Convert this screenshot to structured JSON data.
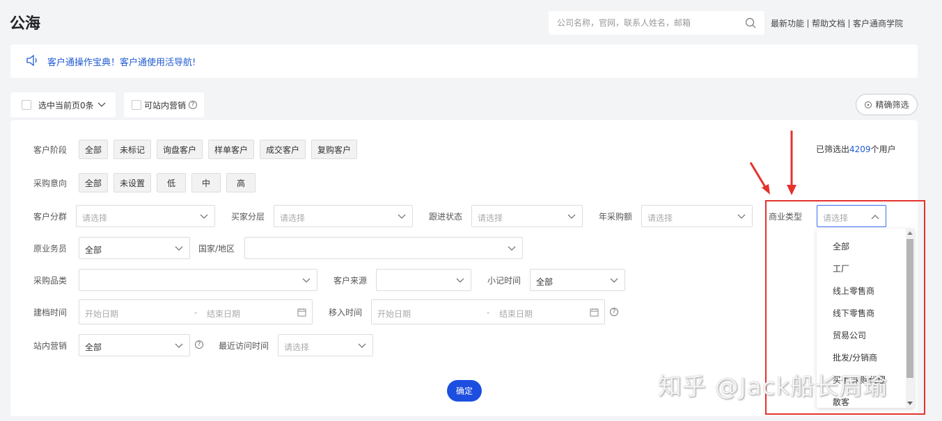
{
  "page": {
    "title": "公海"
  },
  "search": {
    "placeholder": "公司名称，官网，联系人姓名，邮箱"
  },
  "top_links": [
    "最新功能",
    "帮助文档",
    "客户通商学院"
  ],
  "notice": {
    "text": "客户通操作宝典！客户通使用活导航!"
  },
  "toolbar": {
    "select_page": "选中当前页0条",
    "site_marketing": "可站内营销",
    "precise_filter": "精确筛选"
  },
  "filter": {
    "stage_label": "客户阶段",
    "stage_tags": [
      "全部",
      "未标记",
      "询盘客户",
      "样单客户",
      "成交客户",
      "复购客户"
    ],
    "intent_label": "采购意向",
    "intent_tags": [
      "全部",
      "未设置",
      "低",
      "中",
      "高"
    ],
    "result_prefix": "已筛选出",
    "result_count": "4209",
    "result_suffix": "个用户",
    "group_label": "客户分群",
    "buyer_level_label": "买家分层",
    "follow_status_label": "跟进状态",
    "annual_purchase_label": "年采购额",
    "business_type_label": "商业类型",
    "placeholder": "请选择",
    "original_staff_label": "原业务员",
    "original_staff_value": "全部",
    "country_label": "国家/地区",
    "category_label": "采购品类",
    "source_label": "客户来源",
    "note_time_label": "小记时间",
    "note_time_value": "全部",
    "created_label": "建档时间",
    "moved_label": "移入时间",
    "start_date": "开始日期",
    "end_date": "结束日期",
    "date_sep": "-",
    "site_marketing_label": "站内营销",
    "site_marketing_value": "全部",
    "last_visit_label": "最近访问时间",
    "confirm": "确定"
  },
  "business_type_options": [
    "全部",
    "工厂",
    "线上零售商",
    "线下零售商",
    "贸易公司",
    "批发/分销商",
    "买手/采购代理",
    "散客"
  ],
  "watermark": "知乎 @Jack船长周瑜",
  "colors": {
    "accent": "#1c4fe0",
    "link": "#1f5bd1",
    "highlight": "#e5322d"
  }
}
